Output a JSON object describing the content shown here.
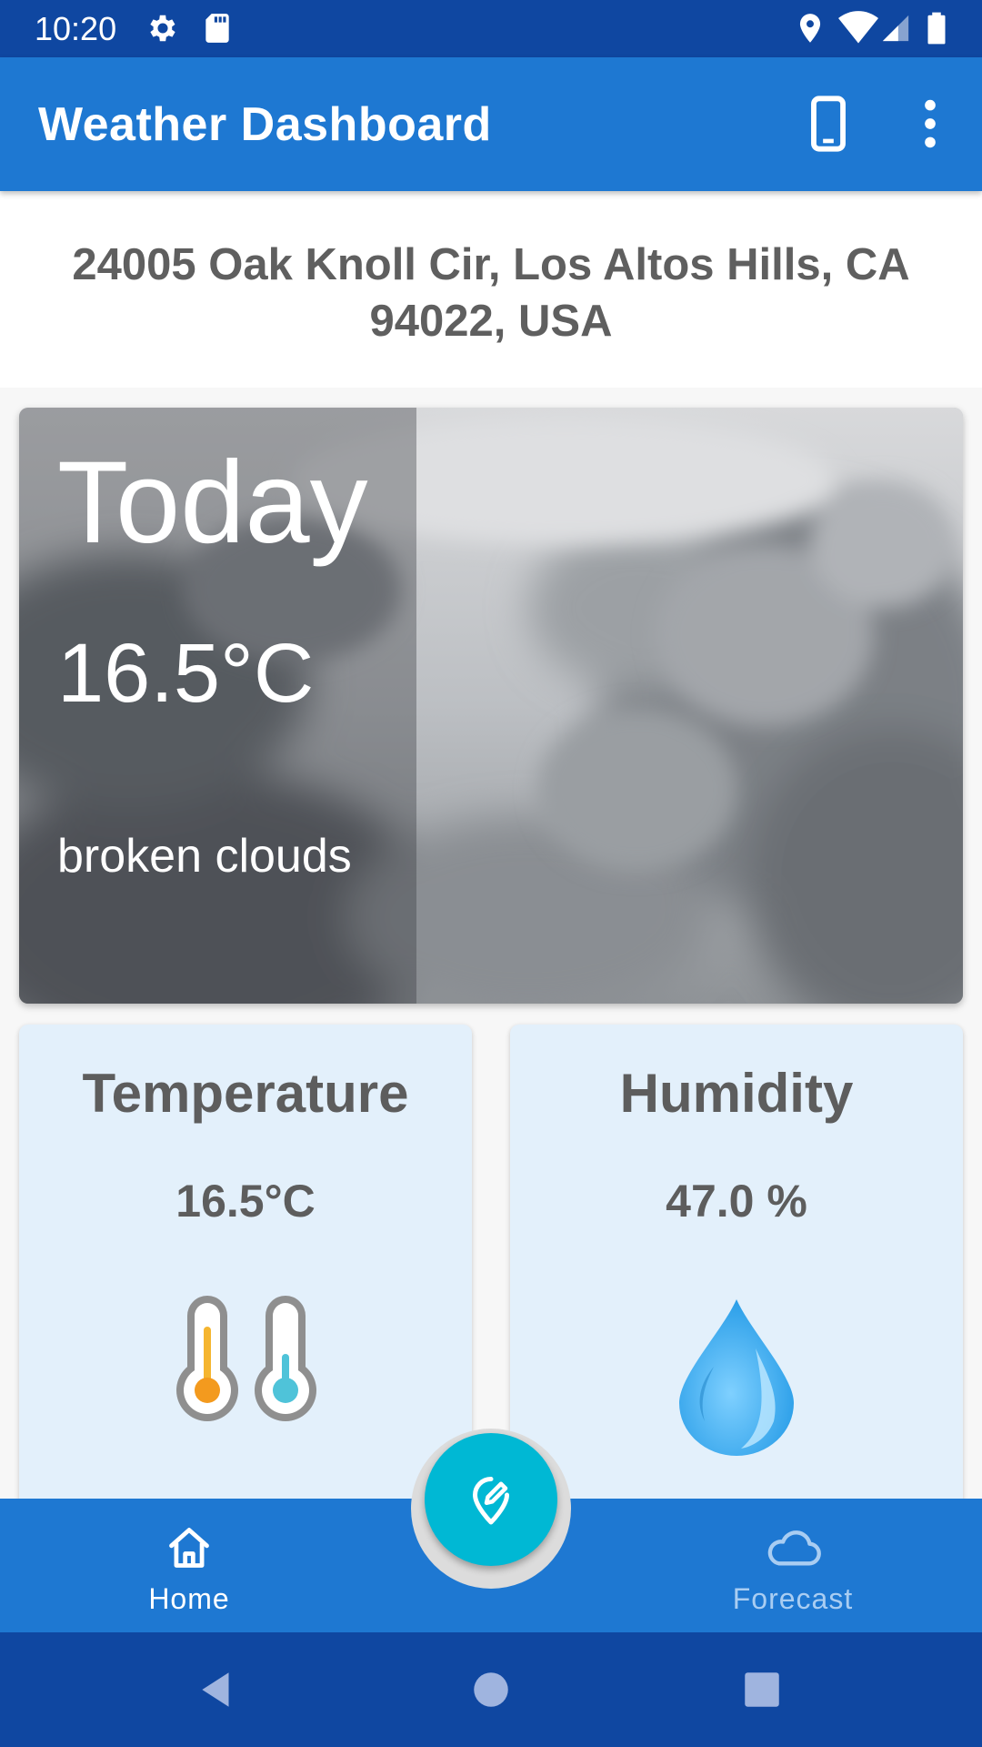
{
  "status_bar": {
    "time": "10:20",
    "left_icons": [
      "gear-icon",
      "sd-card-icon"
    ],
    "right_icons": [
      "location-pin-icon",
      "wifi-icon",
      "signal-icon",
      "battery-icon"
    ]
  },
  "app_bar": {
    "title": "Weather Dashboard",
    "actions": [
      "phone-device-icon",
      "more-vert-icon"
    ]
  },
  "address": "24005 Oak Knoll Cir, Los Altos Hills, CA 94022, USA",
  "today": {
    "heading": "Today",
    "temperature": "16.5°C",
    "description": "broken clouds"
  },
  "cards": {
    "temperature": {
      "title": "Temperature",
      "value": "16.5°C",
      "icon": "thermometer-icon"
    },
    "humidity": {
      "title": "Humidity",
      "value": "47.0 %",
      "icon": "water-drop-icon"
    }
  },
  "bottom_nav": {
    "home_label": "Home",
    "forecast_label": "Forecast",
    "fab_icon": "edit-location-icon"
  },
  "colors": {
    "primary": "#1e78d2",
    "primary_dark": "#0f47a1",
    "accent": "#00b8d4",
    "card_bg": "#e3f0fb"
  }
}
